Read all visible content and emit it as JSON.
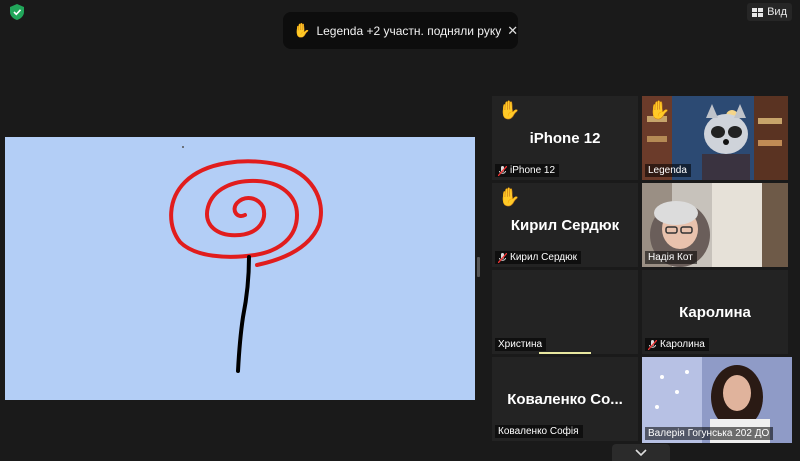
{
  "toolbar": {
    "view_label": "Вид"
  },
  "notification": {
    "text": "Legenda +2 участн. подняли руку",
    "close_glyph": "✕",
    "hand_glyph": "✋"
  },
  "participants": [
    {
      "name": "iPhone 12",
      "big_name": "iPhone 12",
      "hand_raised": true,
      "muted": true
    },
    {
      "name": "Legenda",
      "big_name": "",
      "hand_raised": true,
      "muted": false,
      "video": true
    },
    {
      "name": "Кирил Сердюк",
      "big_name": "Кирил Сердюк",
      "hand_raised": true,
      "muted": true
    },
    {
      "name": "Надія Кот",
      "big_name": "",
      "hand_raised": false,
      "muted": false,
      "video": true
    },
    {
      "name": "Христина",
      "big_name": "",
      "hand_raised": false,
      "muted": false,
      "speaking_bar": true
    },
    {
      "name": "Каролина",
      "big_name": "Каролина",
      "hand_raised": false,
      "muted": true
    },
    {
      "name": "Коваленко Софія",
      "big_name": "Коваленко Со...",
      "hand_raised": false,
      "muted": false
    },
    {
      "name": "Валерія Гогунська 202 ДО",
      "big_name": "",
      "hand_raised": false,
      "muted": false,
      "video": true,
      "active_speaker": true
    }
  ],
  "colors": {
    "whiteboard_bg": "#b3cef6",
    "spiral": "#e11d1d",
    "stem": "#000000",
    "active_border": "#e2e88a"
  },
  "icons": [
    "shield-check-icon",
    "view-grid-icon",
    "raised-hand-icon",
    "muted-mic-icon",
    "close-icon",
    "chevron-down-icon"
  ]
}
